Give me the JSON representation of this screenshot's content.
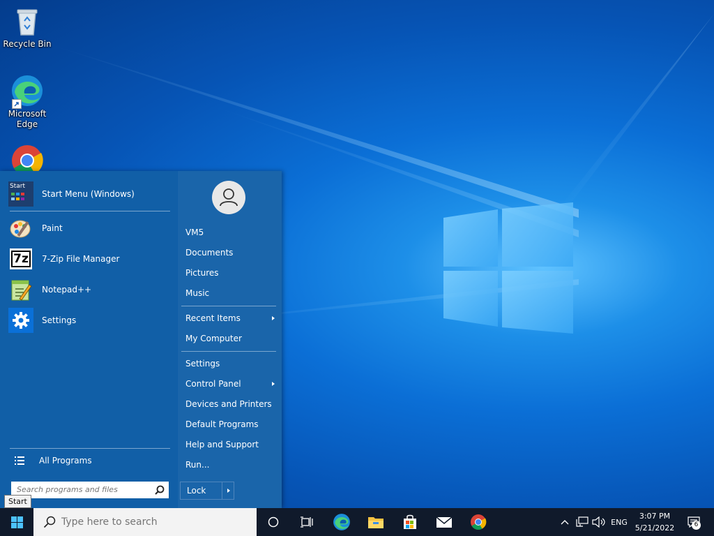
{
  "desktop": {
    "icons": [
      {
        "label": "Recycle Bin",
        "icon": "recycle-bin-icon"
      },
      {
        "label": "Microsoft\nEdge",
        "icon": "edge-icon"
      },
      {
        "label": "",
        "icon": "chrome-icon"
      }
    ]
  },
  "start_menu": {
    "pinned": [
      {
        "label": "Start Menu (Windows)",
        "icon": "start-menu-app-icon",
        "icon_text": "Start"
      },
      {
        "label": "Paint",
        "icon": "paint-icon"
      },
      {
        "label": "7-Zip File Manager",
        "icon": "seven-zip-icon",
        "icon_text": "7z"
      },
      {
        "label": "Notepad++",
        "icon": "notepad-plus-plus-icon"
      },
      {
        "label": "Settings",
        "icon": "settings-gear-icon"
      }
    ],
    "all_programs": "All Programs",
    "search_placeholder": "Search programs and files",
    "right": {
      "user": "VM5",
      "group1": [
        "Documents",
        "Pictures",
        "Music"
      ],
      "recent_items": "Recent Items",
      "my_computer": "My Computer",
      "settings": "Settings",
      "control_panel": "Control Panel",
      "devices_printers": "Devices and Printers",
      "default_programs": "Default Programs",
      "help_support": "Help and Support",
      "run": "Run..."
    },
    "lock_label": "Lock"
  },
  "tooltip": "Start",
  "taskbar": {
    "search_placeholder": "Type here to search",
    "language": "ENG",
    "time": "3:07 PM",
    "date": "5/21/2022",
    "notification_count": "6"
  },
  "colors": {
    "taskbar": "#101a2b",
    "start_menu": "#115fa7",
    "accent": "#0b6fd6"
  }
}
